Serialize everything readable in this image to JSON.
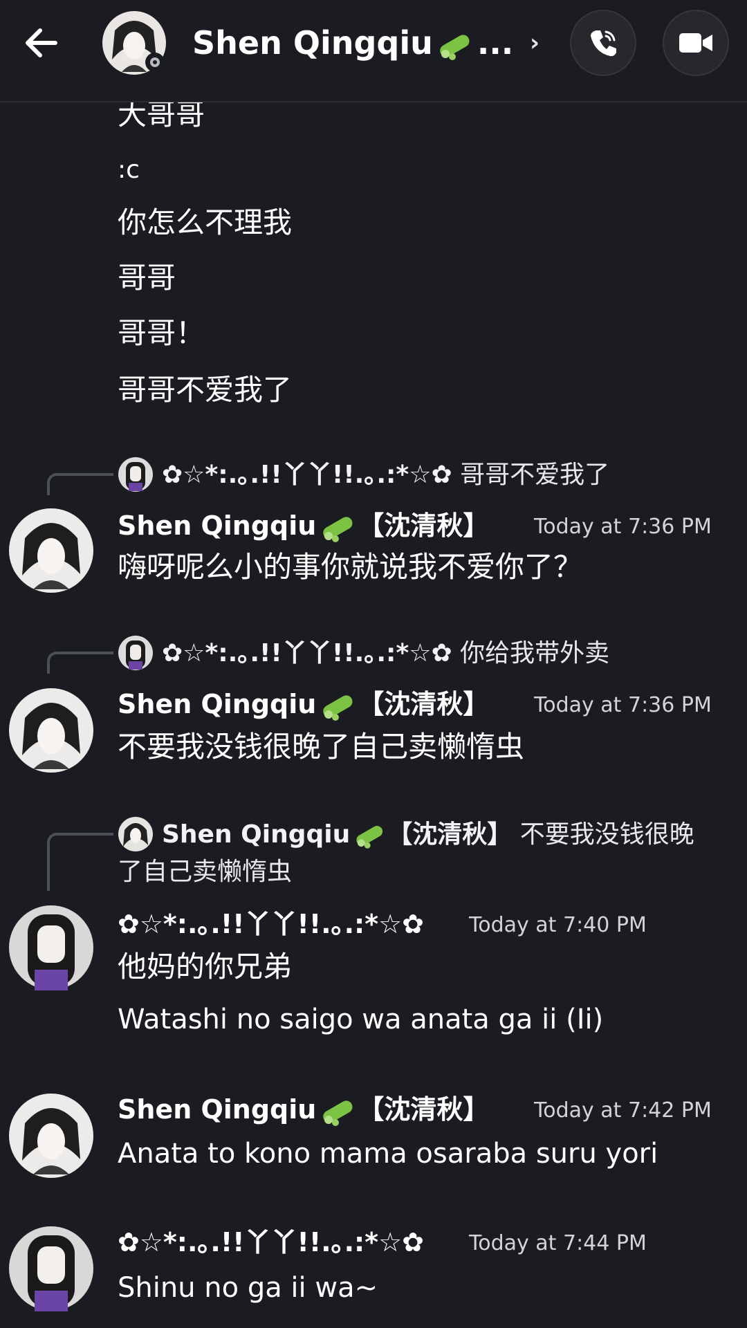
{
  "header": {
    "title": "Shen Qingqiu",
    "ellipsis": "...",
    "chevron": "›",
    "icons": {
      "back": "arrow-left-icon",
      "call": "phone-icon",
      "video": "video-camera-icon",
      "emoji": "cucumber-emoji-icon"
    }
  },
  "earlier_lines": [
    "大哥哥",
    ":c",
    "你怎么不理我",
    "哥哥",
    "哥哥！",
    "哥哥不爱我了"
  ],
  "users": {
    "shen": "Shen Qingqiu",
    "shen_suffix": "【沈清秋】",
    "other": "✿☆*:.｡.!!丫丫!!.｡.:*☆✿"
  },
  "messages": [
    {
      "reply": {
        "author": "✿☆*:.｡.!!丫丫!!.｡.:*☆✿",
        "text": "哥哥不爱我了"
      },
      "timestamp": "Today at 7:36 PM",
      "lines": [
        "嗨呀呢么小的事你就说我不爱你了？"
      ]
    },
    {
      "reply": {
        "author": "✿☆*:.｡.!!丫丫!!.｡.:*☆✿",
        "text": "你给我带外卖"
      },
      "timestamp": "Today at 7:36 PM",
      "lines": [
        "不要我没钱很晚了自己卖懒惰虫"
      ]
    },
    {
      "reply": {
        "author": "Shen Qingqiu",
        "author_suffix": "【沈清秋】",
        "text_1": "不要我没钱很晚",
        "text_2": "了自己卖懒惰虫"
      },
      "timestamp": "Today at 7:40 PM",
      "lines": [
        "他妈的你兄弟",
        "Watashi no saigo wa anata ga ii (Ii)"
      ]
    },
    {
      "timestamp": "Today at 7:42 PM",
      "lines": [
        "Anata to kono mama osaraba suru yori"
      ]
    },
    {
      "timestamp": "Today at 7:44 PM",
      "lines": [
        "Shinu no ga ii wa~"
      ]
    }
  ]
}
